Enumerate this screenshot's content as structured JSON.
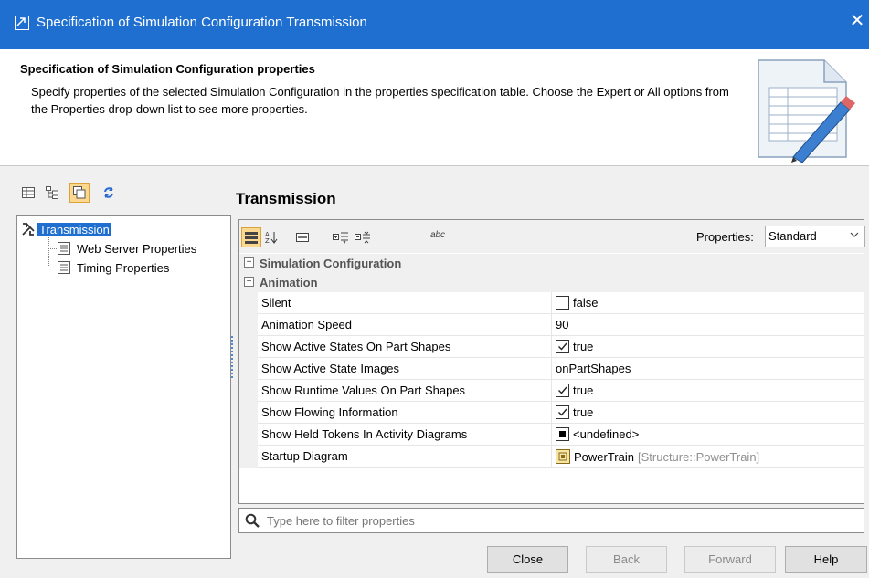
{
  "window": {
    "title": "Specification of Simulation Configuration Transmission",
    "close_glyph": "✕"
  },
  "header": {
    "title": "Specification of Simulation Configuration properties",
    "description": "Specify properties of the selected Simulation Configuration in the properties specification table. Choose the Expert or All options from the Properties drop-down list to see more properties."
  },
  "left_toolbar": {
    "buttons": [
      "table-view-icon",
      "tree-view-icon",
      "copy-view-icon",
      "refresh-icon"
    ]
  },
  "tree": {
    "root": "Transmission",
    "children": [
      "Web Server Properties",
      "Timing Properties"
    ]
  },
  "panel": {
    "title": "Transmission"
  },
  "props_toolbar": {
    "properties_label": "Properties:",
    "properties_value": "Standard",
    "abc_label": "abc"
  },
  "groups": {
    "simulation_configuration": "Simulation Configuration",
    "animation": "Animation"
  },
  "rows": [
    {
      "name": "Silent",
      "value": "false"
    },
    {
      "name": "Animation Speed",
      "value": "90"
    },
    {
      "name": "Show Active States On Part Shapes",
      "value": "true"
    },
    {
      "name": "Show Active State Images",
      "value": "onPartShapes"
    },
    {
      "name": "Show Runtime Values On Part Shapes",
      "value": "true"
    },
    {
      "name": "Show Flowing Information",
      "value": "true"
    },
    {
      "name": "Show Held Tokens In Activity Diagrams",
      "value": "<undefined>"
    },
    {
      "name": "Startup Diagram",
      "value": "PowerTrain",
      "qualifier": "[Structure::PowerTrain]"
    }
  ],
  "filter": {
    "placeholder": "Type here to filter properties"
  },
  "buttons": {
    "close": "Close",
    "back": "Back",
    "forward": "Forward",
    "help": "Help"
  },
  "colors": {
    "titlebar": "#1e6fcf",
    "selection": "#1e6fcf",
    "active_toggle": "#fbd78f"
  }
}
